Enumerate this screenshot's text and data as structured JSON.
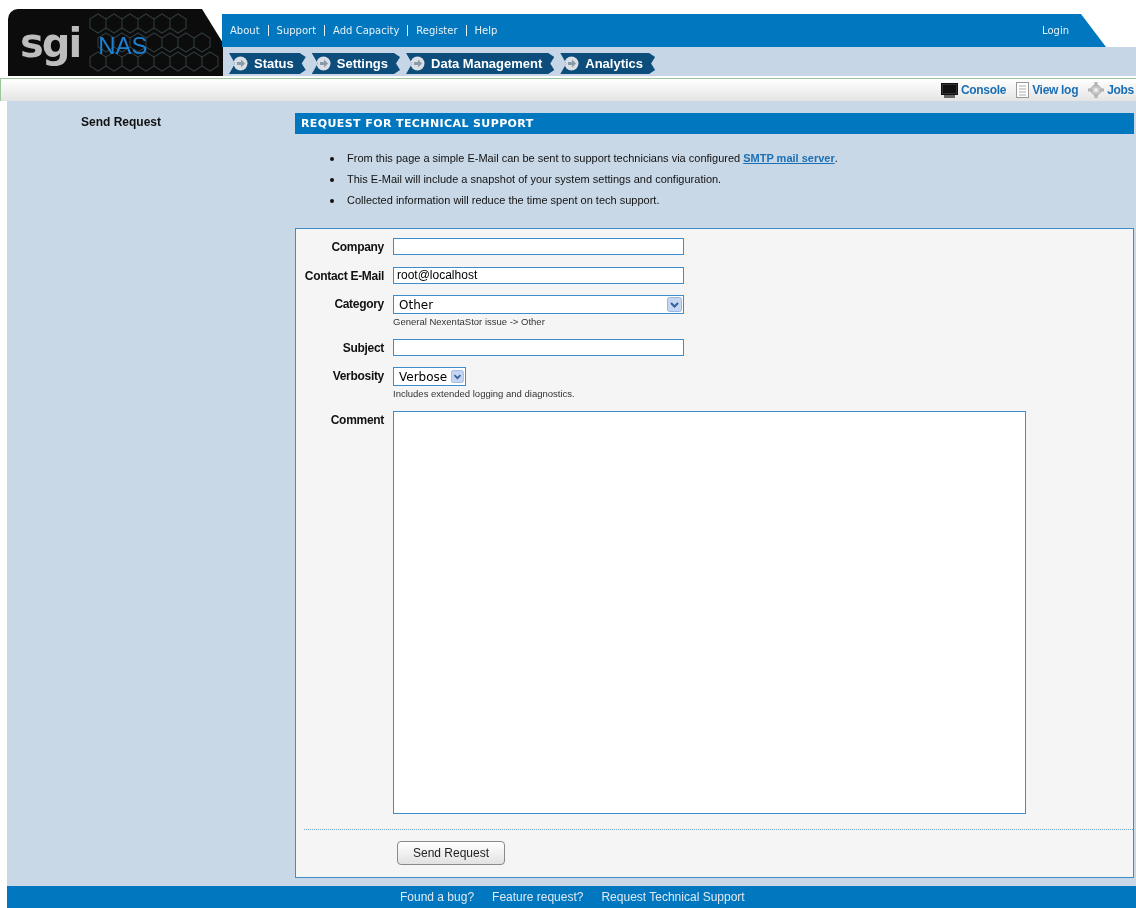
{
  "header": {
    "logo": "sgi",
    "product": "NAS",
    "top_links": [
      "About",
      "Support",
      "Add Capacity",
      "Register",
      "Help"
    ],
    "login": "Login"
  },
  "tabs": [
    {
      "label": "Status",
      "selected": false
    },
    {
      "label": "Settings",
      "selected": false
    },
    {
      "label": "Data Management",
      "selected": false
    },
    {
      "label": "Analytics",
      "selected": false
    }
  ],
  "toolbar": [
    {
      "kind": "monitor",
      "label": "Console"
    },
    {
      "kind": "document",
      "label": "View log"
    },
    {
      "kind": "gear",
      "label": "Jobs"
    }
  ],
  "sidebar": {
    "items": [
      {
        "label": "Send Request"
      }
    ]
  },
  "section": {
    "title": "REQUEST FOR TECHNICAL SUPPORT",
    "bullets": [
      {
        "text": "From this page a simple E-Mail can be sent to support technicians via configured ",
        "link": "SMTP mail server",
        "after": "."
      },
      {
        "text": "This E-Mail will include a snapshot of your system settings and configuration."
      },
      {
        "text": "Collected information will reduce the time spent on tech support."
      }
    ]
  },
  "form": {
    "fields": [
      {
        "kind": "text",
        "label": "Company"
      },
      {
        "kind": "text",
        "label": "Contact E-Mail",
        "value": "root@localhost"
      },
      {
        "kind": "select",
        "label": "Category",
        "value": "Other",
        "hint": "General NexentaStor issue -> Other"
      },
      {
        "kind": "text",
        "label": "Subject"
      },
      {
        "kind": "select-small",
        "label": "Verbosity",
        "value": "Verbose",
        "hint": "Includes extended logging and diagnostics."
      },
      {
        "kind": "textarea",
        "label": "Comment"
      }
    ],
    "submit": "Send Request"
  },
  "footer": {
    "links": [
      "Found a bug?",
      "Feature request?",
      "Request Technical Support"
    ]
  }
}
